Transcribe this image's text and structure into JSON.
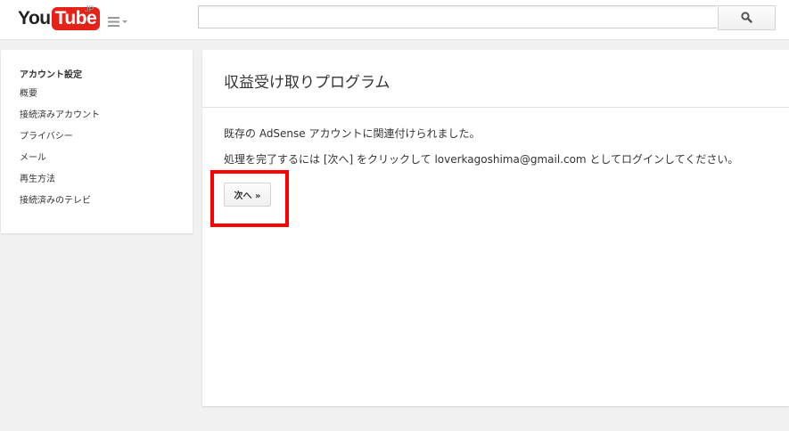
{
  "header": {
    "logo_you": "You",
    "logo_tube": "Tube",
    "logo_region": "JP",
    "guide_icon": "menu-icon",
    "search": {
      "placeholder": "",
      "value": "",
      "icon": "search-icon"
    }
  },
  "sidebar": {
    "title": "アカウント設定",
    "items": [
      {
        "label": "概要"
      },
      {
        "label": "接続済みアカウント"
      },
      {
        "label": "プライバシー"
      },
      {
        "label": "メール"
      },
      {
        "label": "再生方法"
      },
      {
        "label": "接続済みのテレビ"
      }
    ]
  },
  "main": {
    "title": "収益受け取りプログラム",
    "message1": "既存の AdSense アカウントに関連付けられました。",
    "message2": "処理を完了するには [次へ] をクリックして loverkagoshima@gmail.com としてログインしてください。",
    "next_button": "次へ »"
  },
  "colors": {
    "brand_red": "#e62117",
    "highlight": "#ff0000",
    "background": "#f1f1f1"
  }
}
